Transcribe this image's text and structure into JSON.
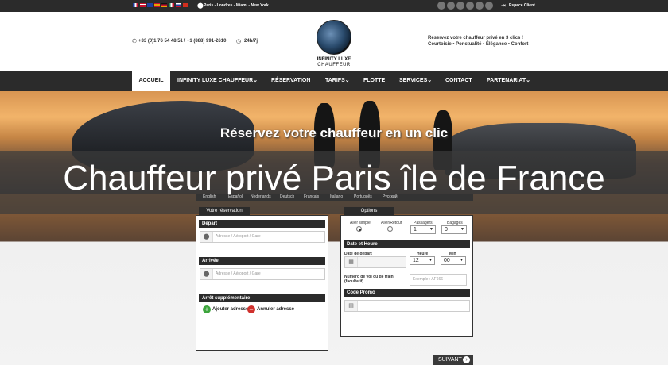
{
  "topbar": {
    "cities": "Paris - Londres - Miami - New York",
    "client_space": "Espace Client",
    "flag_colors": [
      "#1f3fa0",
      "#c8102e",
      "#e9a200",
      "#555555",
      "#2e8b57",
      "#1f3fa0",
      "#c8102e",
      "#d22e1e"
    ]
  },
  "header": {
    "phone": "+33 (0)1 76 54 48 51 / +1 (888) 991-2610",
    "hours": "24h/7j",
    "logo_line1": "INFINITY LUXE",
    "logo_line2": "CHAUFFEUR",
    "promo_line1": "Réservez votre chauffeur privé en 3 clics !",
    "promo_line2": "Courtoisie • Ponctualité • Élégance • Confort"
  },
  "nav": {
    "items": [
      {
        "label": "ACCUEIL"
      },
      {
        "label": "INFINITY LUXE CHAUFFEUR"
      },
      {
        "label": "RÉSERVATION"
      },
      {
        "label": "TARIFS"
      },
      {
        "label": "FLOTTE"
      },
      {
        "label": "SERVICES"
      },
      {
        "label": "CONTACT"
      },
      {
        "label": "PARTENARIAT"
      }
    ]
  },
  "hero": {
    "subtitle": "Réservez votre chauffeur en un clic",
    "title": "Chauffeur privé Paris île de France",
    "languages": [
      "English",
      "Español",
      "Nederlands",
      "Deutsch",
      "Français",
      "Italiano",
      "Português",
      "Русский"
    ]
  },
  "booking": {
    "tab_label": "Votre réservation",
    "depart_header": "Départ",
    "depart_placeholder": "Adresse / Aéroport / Gare",
    "arrivee_header": "Arrivée",
    "arrivee_placeholder": "Adresse / Aéroport / Gare",
    "extra_header": "Arrêt supplémentaire",
    "add_address": "Ajouter adresse",
    "cancel_address": "Annuler adresse"
  },
  "options": {
    "tab_label": "Options",
    "aller_simple": "Aller simple",
    "aller_retour": "Aller/Retour",
    "passagers_label": "Passagers",
    "passagers_value": "1",
    "bagages_label": "Bagages",
    "bagages_value": "0",
    "date_header": "Date et Heure",
    "date_label": "Date de départ",
    "heure_label": "Heure",
    "heure_value": "12",
    "min_label": "Min",
    "min_value": "00",
    "flight_label_1": "Numéro de vol ou de train",
    "flight_label_2": "(facultatif)",
    "flight_placeholder": "Exemple : AF666",
    "promo_header": "Code Promo"
  },
  "footer": {
    "next_button": "SUIVANT"
  }
}
